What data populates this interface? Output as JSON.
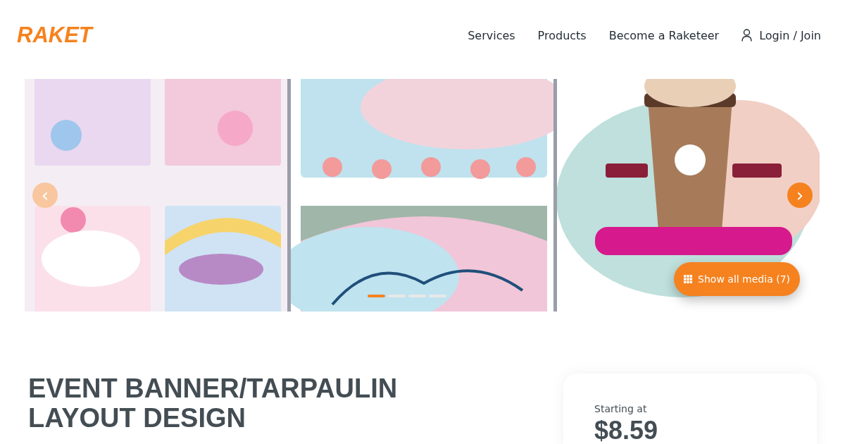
{
  "header": {
    "logo": "RAKET",
    "nav": [
      "Services",
      "Products",
      "Become a Raketeer"
    ],
    "login": "Login / Join"
  },
  "gallery": {
    "prev": {
      "label": "‹",
      "disabled": true
    },
    "next": {
      "label": "›",
      "disabled": false
    },
    "dots": [
      {
        "selected": true
      },
      {
        "selected": false
      },
      {
        "selected": false
      },
      {
        "selected": false
      }
    ],
    "show_all": "Show all media (7)"
  },
  "title": "EVENT BANNER/TARPAULIN LAYOUT DESIGN",
  "price_card": {
    "caption": "Starting at",
    "price": "$8.59"
  }
}
